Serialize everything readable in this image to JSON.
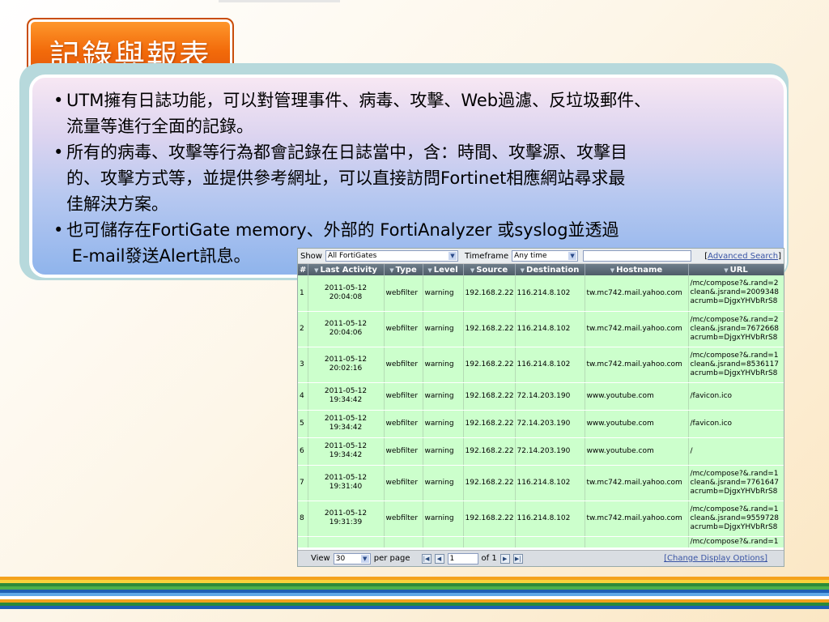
{
  "slide": {
    "title": "記錄與報表",
    "bullets": [
      {
        "line1": "UTM擁有日誌功能，可以對管理事件、病毒、攻擊、Web過濾、反垃圾郵件、",
        "line2": "流量等進行全面的記錄。"
      },
      {
        "line1": "所有的病毒、攻擊等行為都會記錄在日誌當中，含：時間、攻擊源、攻擊目",
        "line2": "的、攻擊方式等，並提供參考網址，可以直接訪問Fortinet相應網站尋求最",
        "line3": "佳解決方案。"
      },
      {
        "line1": "也可儲存在FortiGate  memory、外部的 FortiAnalyzer 或syslog並透過",
        "line2": " E-mail發送Alert訊息。"
      }
    ],
    "bullet_char": "•"
  },
  "log_viewer": {
    "filter": {
      "show_label": "Show",
      "show_value": "All FortiGates",
      "timeframe_label": "Timeframe",
      "timeframe_value": "Any time",
      "advanced_search": "Advanced Search"
    },
    "columns": [
      "#",
      "Last Activity",
      "Type",
      "Level",
      "Source",
      "Destination",
      "Hostname",
      "URL"
    ],
    "rows": [
      {
        "n": "1",
        "date": "2011-05-12",
        "time": "20:04:08",
        "type": "webfilter",
        "level": "warning",
        "src": "192.168.2.22",
        "dst": "116.214.8.102",
        "host": "tw.mc742.mail.yahoo.com",
        "url": "/mc/compose?&.rand=2 clean&.jsrand=2009348 acrumb=DjgxYHVbRrS8"
      },
      {
        "n": "2",
        "date": "2011-05-12",
        "time": "20:04:06",
        "type": "webfilter",
        "level": "warning",
        "src": "192.168.2.22",
        "dst": "116.214.8.102",
        "host": "tw.mc742.mail.yahoo.com",
        "url": "/mc/compose?&.rand=2 clean&.jsrand=7672668 acrumb=DjgxYHVbRrS8"
      },
      {
        "n": "3",
        "date": "2011-05-12",
        "time": "20:02:16",
        "type": "webfilter",
        "level": "warning",
        "src": "192.168.2.22",
        "dst": "116.214.8.102",
        "host": "tw.mc742.mail.yahoo.com",
        "url": "/mc/compose?&.rand=1 clean&.jsrand=8536117 acrumb=DjgxYHVbRrS8"
      },
      {
        "n": "4",
        "date": "2011-05-12",
        "time": "19:34:42",
        "type": "webfilter",
        "level": "warning",
        "src": "192.168.2.22",
        "dst": "72.14.203.190",
        "host": "www.youtube.com",
        "url": "/favicon.ico"
      },
      {
        "n": "5",
        "date": "2011-05-12",
        "time": "19:34:42",
        "type": "webfilter",
        "level": "warning",
        "src": "192.168.2.22",
        "dst": "72.14.203.190",
        "host": "www.youtube.com",
        "url": "/favicon.ico"
      },
      {
        "n": "6",
        "date": "2011-05-12",
        "time": "19:34:42",
        "type": "webfilter",
        "level": "warning",
        "src": "192.168.2.22",
        "dst": "72.14.203.190",
        "host": "www.youtube.com",
        "url": "/"
      },
      {
        "n": "7",
        "date": "2011-05-12",
        "time": "19:31:40",
        "type": "webfilter",
        "level": "warning",
        "src": "192.168.2.22",
        "dst": "116.214.8.102",
        "host": "tw.mc742.mail.yahoo.com",
        "url": "/mc/compose?&.rand=1 clean&.jsrand=7761647 acrumb=DjgxYHVbRrS8"
      },
      {
        "n": "8",
        "date": "2011-05-12",
        "time": "19:31:39",
        "type": "webfilter",
        "level": "warning",
        "src": "192.168.2.22",
        "dst": "116.214.8.102",
        "host": "tw.mc742.mail.yahoo.com",
        "url": "/mc/compose?&.rand=1 clean&.jsrand=9559728 acrumb=DjgxYHVbRrS8"
      }
    ],
    "partial_row_url": "/mc/compose?&.rand=1",
    "pager": {
      "view_label": "View",
      "per_page_value": "30",
      "per_page_label": "per page",
      "page_value": "1",
      "of_label": "of 1",
      "change_display": "[Change Display Options]"
    }
  },
  "colors": {
    "title_orange": "#f26a0a",
    "row_green": "#ccffcc",
    "header_gray": "#5b6874",
    "stripes": [
      "#f4a21c",
      "#f7d23a",
      "#2a8a3a",
      "#4ab04a",
      "#1e5fb4",
      "#60a8e8",
      "#ffffff",
      "#f4a21c",
      "#2a8a3a",
      "#1e5fb4"
    ]
  }
}
